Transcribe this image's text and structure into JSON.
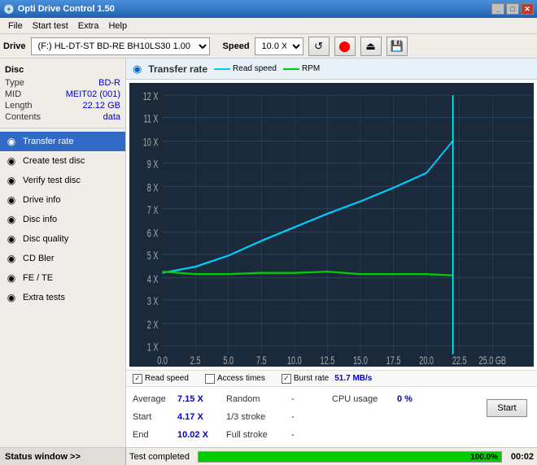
{
  "titlebar": {
    "title": "Opti Drive Control 1.50",
    "icon": "💿",
    "controls": [
      "_",
      "□",
      "✕"
    ]
  },
  "menubar": {
    "items": [
      "File",
      "Start test",
      "Extra",
      "Help"
    ]
  },
  "drivebar": {
    "drive_label": "Drive",
    "drive_value": "(F:)  HL-DT-ST BD-RE  BH10LS30 1.00",
    "speed_label": "Speed",
    "speed_value": "10.0 X ▼",
    "buttons": [
      "↺",
      "🔴",
      "💾",
      "💾"
    ]
  },
  "disc": {
    "title": "Disc",
    "rows": [
      {
        "key": "Type",
        "val": "BD-R"
      },
      {
        "key": "MID",
        "val": "MEIT02 (001)"
      },
      {
        "key": "Length",
        "val": "22.12 GB"
      },
      {
        "key": "Contents",
        "val": "data"
      }
    ]
  },
  "sidebar_buttons": [
    {
      "id": "transfer-rate",
      "label": "Transfer rate",
      "icon": "◉",
      "active": true
    },
    {
      "id": "create-test-disc",
      "label": "Create test disc",
      "icon": "◉"
    },
    {
      "id": "verify-test-disc",
      "label": "Verify test disc",
      "icon": "◉"
    },
    {
      "id": "drive-info",
      "label": "Drive info",
      "icon": "◉"
    },
    {
      "id": "disc-info",
      "label": "Disc info",
      "icon": "◉"
    },
    {
      "id": "disc-quality",
      "label": "Disc quality",
      "icon": "◉"
    },
    {
      "id": "cd-bler",
      "label": "CD Bler",
      "icon": "◉"
    },
    {
      "id": "fe-te",
      "label": "FE / TE",
      "icon": "◉"
    },
    {
      "id": "extra-tests",
      "label": "Extra tests",
      "icon": "◉"
    }
  ],
  "chart": {
    "title": "Transfer rate",
    "legend": [
      {
        "label": "Read speed",
        "color": "#00ccff"
      },
      {
        "label": "RPM",
        "color": "#00cc00"
      }
    ],
    "y_max": 12,
    "x_max": 25,
    "burst_label": "Burst rate",
    "burst_value": "51.7 MB/s"
  },
  "checkboxes": [
    {
      "label": "Read speed",
      "checked": true
    },
    {
      "label": "Access times",
      "checked": false
    },
    {
      "label": "Burst rate",
      "checked": true
    }
  ],
  "stats": [
    {
      "label": "Average",
      "val": "7.15 X",
      "label2": "Random",
      "val2": "-",
      "label3": "CPU usage",
      "val3": "0 %"
    },
    {
      "label": "Start",
      "val": "4.17 X",
      "label2": "1/3 stroke",
      "val2": "-",
      "label3": "",
      "val3": ""
    },
    {
      "label": "End",
      "val": "10.02 X",
      "label2": "Full stroke",
      "val2": "-",
      "label3": "",
      "val3": ""
    }
  ],
  "start_button": "Start",
  "statusbar": {
    "left": "Status window >>",
    "progress": 100,
    "progress_text": "100.0%",
    "time": "00:02",
    "status_text": "Test completed"
  }
}
